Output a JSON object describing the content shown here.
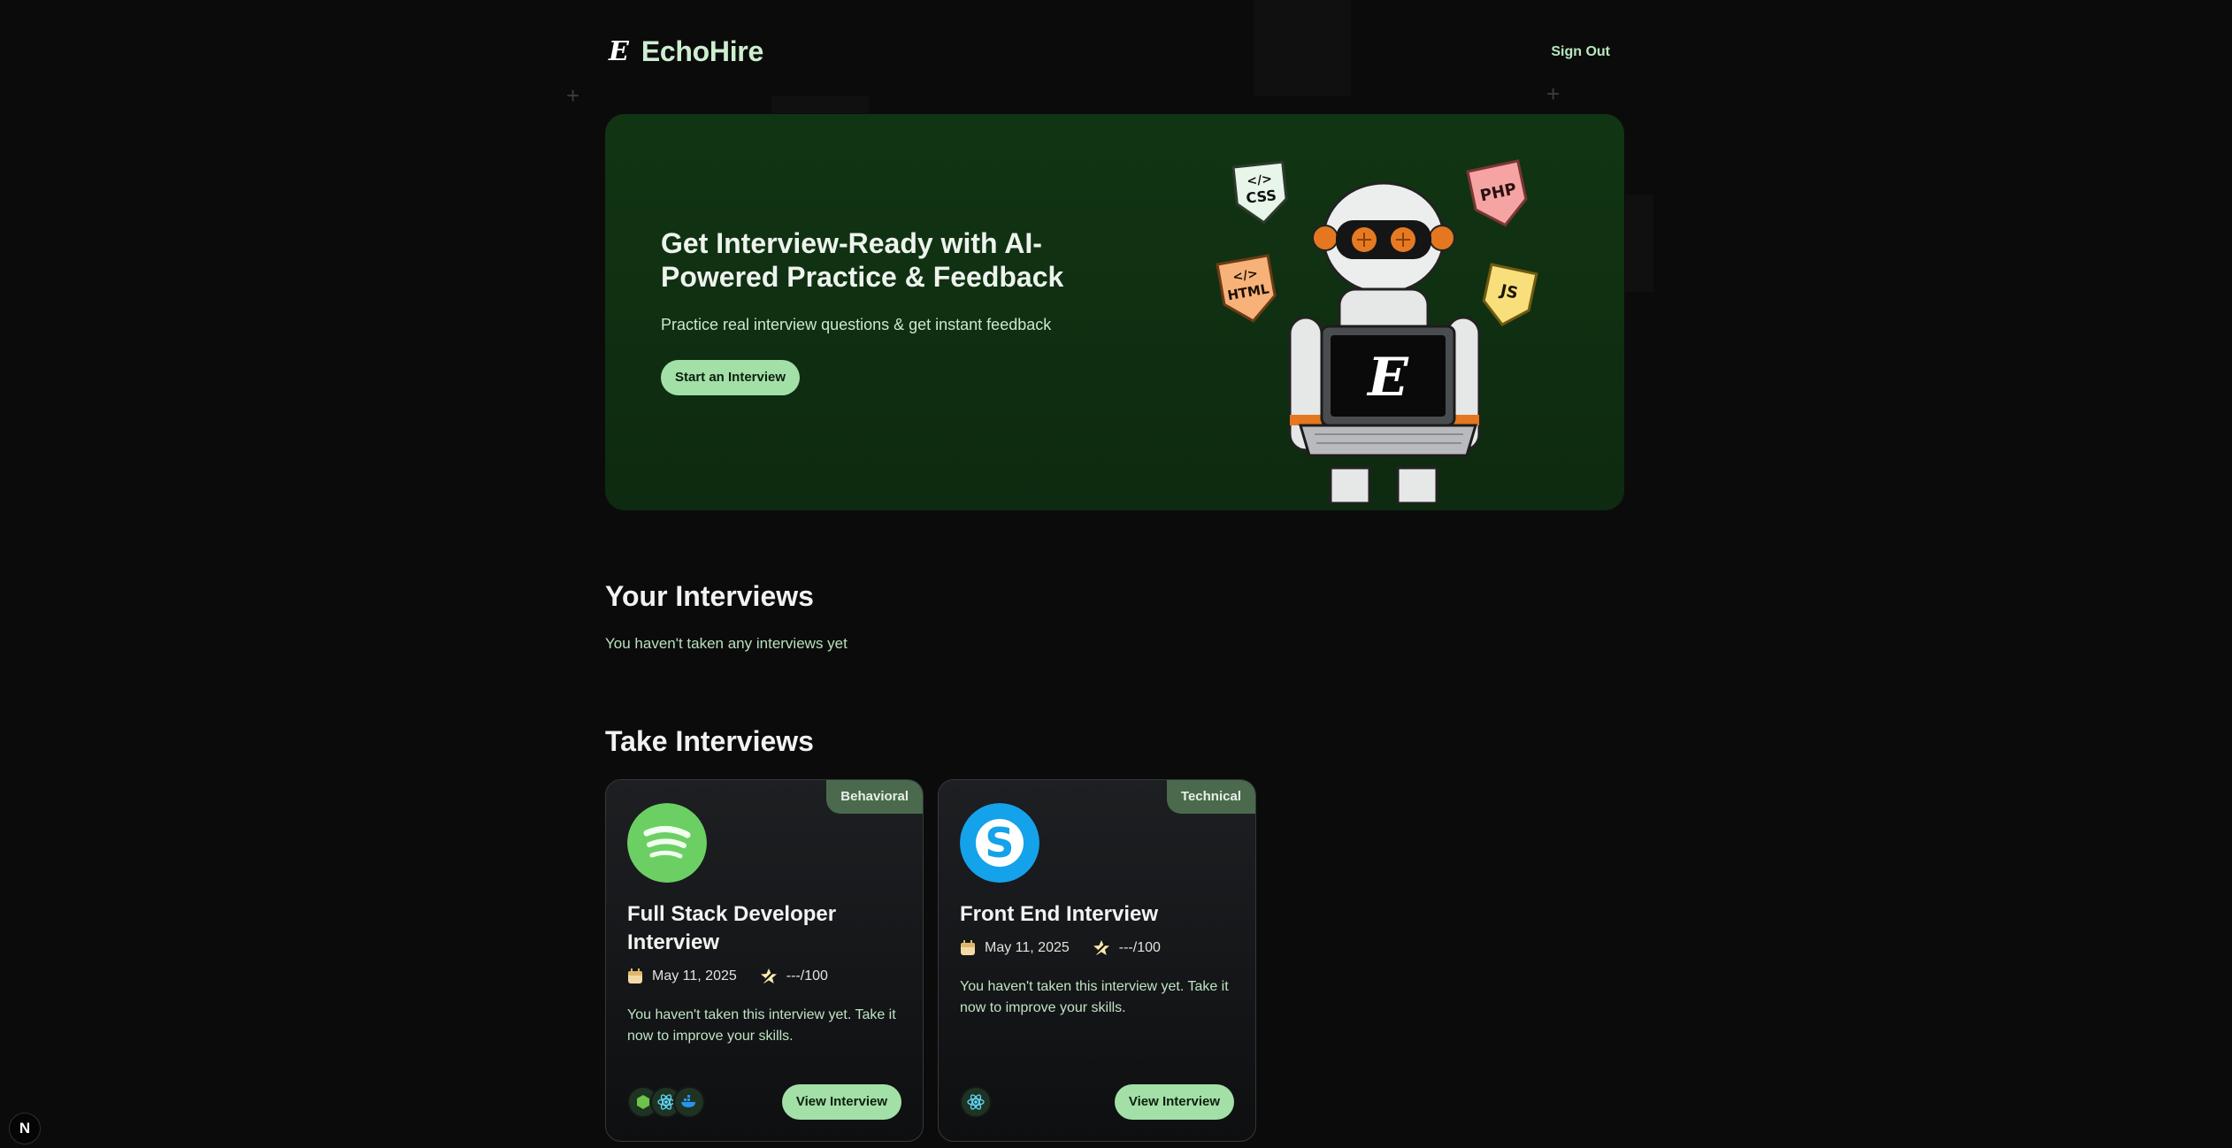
{
  "brand": {
    "name": "EchoHire",
    "mark": "E"
  },
  "header": {
    "sign_out": "Sign Out"
  },
  "hero": {
    "title": "Get Interview-Ready with AI-Powered Practice & Feedback",
    "subtitle": "Practice real interview questions & get instant feedback",
    "cta": "Start an Interview",
    "stickers": [
      "CSS",
      "PHP",
      "HTML",
      "JS"
    ],
    "sticker_code": "</>",
    "laptop_logo": "E"
  },
  "your_interviews": {
    "title": "Your Interviews",
    "empty": "You haven't taken any interviews yet"
  },
  "take_interviews": {
    "title": "Take Interviews",
    "cards": [
      {
        "badge": "Behavioral",
        "logo": "spotify-logo",
        "title": "Full Stack Developer Interview",
        "date": "May 11, 2025",
        "score": "---/100",
        "description": "You haven't taken this interview yet. Take it now to improve your skills.",
        "tech_icons": [
          "nodejs-icon",
          "react-icon",
          "docker-icon"
        ],
        "button": "View Interview"
      },
      {
        "badge": "Technical",
        "logo": "skype-logo",
        "title": "Front End Interview",
        "date": "May 11, 2025",
        "score": "---/100",
        "description": "You haven't taken this interview yet. Take it now to improve your skills.",
        "tech_icons": [
          "react-icon"
        ],
        "button": "View Interview"
      }
    ]
  },
  "dev_badge": "N",
  "colors": {
    "accent": "#a3e0a7",
    "hero_bg": "#113513",
    "badge_bg": "#4b6a4d",
    "page_bg": "#0b0b0c"
  }
}
